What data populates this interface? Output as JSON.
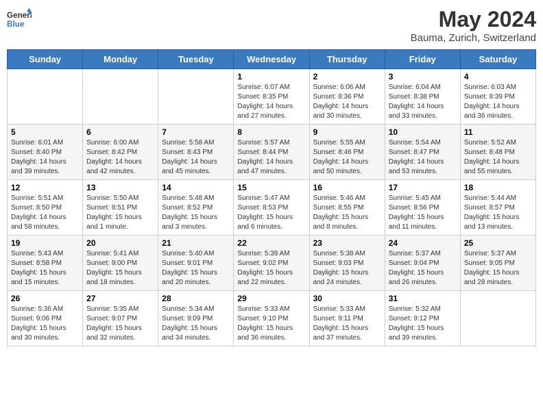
{
  "header": {
    "logo_line1": "General",
    "logo_line2": "Blue",
    "month_year": "May 2024",
    "location": "Bauma, Zurich, Switzerland"
  },
  "weekdays": [
    "Sunday",
    "Monday",
    "Tuesday",
    "Wednesday",
    "Thursday",
    "Friday",
    "Saturday"
  ],
  "weeks": [
    [
      {
        "day": "",
        "info": ""
      },
      {
        "day": "",
        "info": ""
      },
      {
        "day": "",
        "info": ""
      },
      {
        "day": "1",
        "info": "Sunrise: 6:07 AM\nSunset: 8:35 PM\nDaylight: 14 hours\nand 27 minutes."
      },
      {
        "day": "2",
        "info": "Sunrise: 6:06 AM\nSunset: 8:36 PM\nDaylight: 14 hours\nand 30 minutes."
      },
      {
        "day": "3",
        "info": "Sunrise: 6:04 AM\nSunset: 8:38 PM\nDaylight: 14 hours\nand 33 minutes."
      },
      {
        "day": "4",
        "info": "Sunrise: 6:03 AM\nSunset: 8:39 PM\nDaylight: 14 hours\nand 36 minutes."
      }
    ],
    [
      {
        "day": "5",
        "info": "Sunrise: 6:01 AM\nSunset: 8:40 PM\nDaylight: 14 hours\nand 39 minutes."
      },
      {
        "day": "6",
        "info": "Sunrise: 6:00 AM\nSunset: 8:42 PM\nDaylight: 14 hours\nand 42 minutes."
      },
      {
        "day": "7",
        "info": "Sunrise: 5:58 AM\nSunset: 8:43 PM\nDaylight: 14 hours\nand 45 minutes."
      },
      {
        "day": "8",
        "info": "Sunrise: 5:57 AM\nSunset: 8:44 PM\nDaylight: 14 hours\nand 47 minutes."
      },
      {
        "day": "9",
        "info": "Sunrise: 5:55 AM\nSunset: 8:46 PM\nDaylight: 14 hours\nand 50 minutes."
      },
      {
        "day": "10",
        "info": "Sunrise: 5:54 AM\nSunset: 8:47 PM\nDaylight: 14 hours\nand 53 minutes."
      },
      {
        "day": "11",
        "info": "Sunrise: 5:52 AM\nSunset: 8:48 PM\nDaylight: 14 hours\nand 55 minutes."
      }
    ],
    [
      {
        "day": "12",
        "info": "Sunrise: 5:51 AM\nSunset: 8:50 PM\nDaylight: 14 hours\nand 58 minutes."
      },
      {
        "day": "13",
        "info": "Sunrise: 5:50 AM\nSunset: 8:51 PM\nDaylight: 15 hours\nand 1 minute."
      },
      {
        "day": "14",
        "info": "Sunrise: 5:48 AM\nSunset: 8:52 PM\nDaylight: 15 hours\nand 3 minutes."
      },
      {
        "day": "15",
        "info": "Sunrise: 5:47 AM\nSunset: 8:53 PM\nDaylight: 15 hours\nand 6 minutes."
      },
      {
        "day": "16",
        "info": "Sunrise: 5:46 AM\nSunset: 8:55 PM\nDaylight: 15 hours\nand 8 minutes."
      },
      {
        "day": "17",
        "info": "Sunrise: 5:45 AM\nSunset: 8:56 PM\nDaylight: 15 hours\nand 11 minutes."
      },
      {
        "day": "18",
        "info": "Sunrise: 5:44 AM\nSunset: 8:57 PM\nDaylight: 15 hours\nand 13 minutes."
      }
    ],
    [
      {
        "day": "19",
        "info": "Sunrise: 5:43 AM\nSunset: 8:58 PM\nDaylight: 15 hours\nand 15 minutes."
      },
      {
        "day": "20",
        "info": "Sunrise: 5:41 AM\nSunset: 9:00 PM\nDaylight: 15 hours\nand 18 minutes."
      },
      {
        "day": "21",
        "info": "Sunrise: 5:40 AM\nSunset: 9:01 PM\nDaylight: 15 hours\nand 20 minutes."
      },
      {
        "day": "22",
        "info": "Sunrise: 5:39 AM\nSunset: 9:02 PM\nDaylight: 15 hours\nand 22 minutes."
      },
      {
        "day": "23",
        "info": "Sunrise: 5:38 AM\nSunset: 9:03 PM\nDaylight: 15 hours\nand 24 minutes."
      },
      {
        "day": "24",
        "info": "Sunrise: 5:37 AM\nSunset: 9:04 PM\nDaylight: 15 hours\nand 26 minutes."
      },
      {
        "day": "25",
        "info": "Sunrise: 5:37 AM\nSunset: 9:05 PM\nDaylight: 15 hours\nand 28 minutes."
      }
    ],
    [
      {
        "day": "26",
        "info": "Sunrise: 5:36 AM\nSunset: 9:06 PM\nDaylight: 15 hours\nand 30 minutes."
      },
      {
        "day": "27",
        "info": "Sunrise: 5:35 AM\nSunset: 9:07 PM\nDaylight: 15 hours\nand 32 minutes."
      },
      {
        "day": "28",
        "info": "Sunrise: 5:34 AM\nSunset: 9:09 PM\nDaylight: 15 hours\nand 34 minutes."
      },
      {
        "day": "29",
        "info": "Sunrise: 5:33 AM\nSunset: 9:10 PM\nDaylight: 15 hours\nand 36 minutes."
      },
      {
        "day": "30",
        "info": "Sunrise: 5:33 AM\nSunset: 9:11 PM\nDaylight: 15 hours\nand 37 minutes."
      },
      {
        "day": "31",
        "info": "Sunrise: 5:32 AM\nSunset: 9:12 PM\nDaylight: 15 hours\nand 39 minutes."
      },
      {
        "day": "",
        "info": ""
      }
    ]
  ]
}
